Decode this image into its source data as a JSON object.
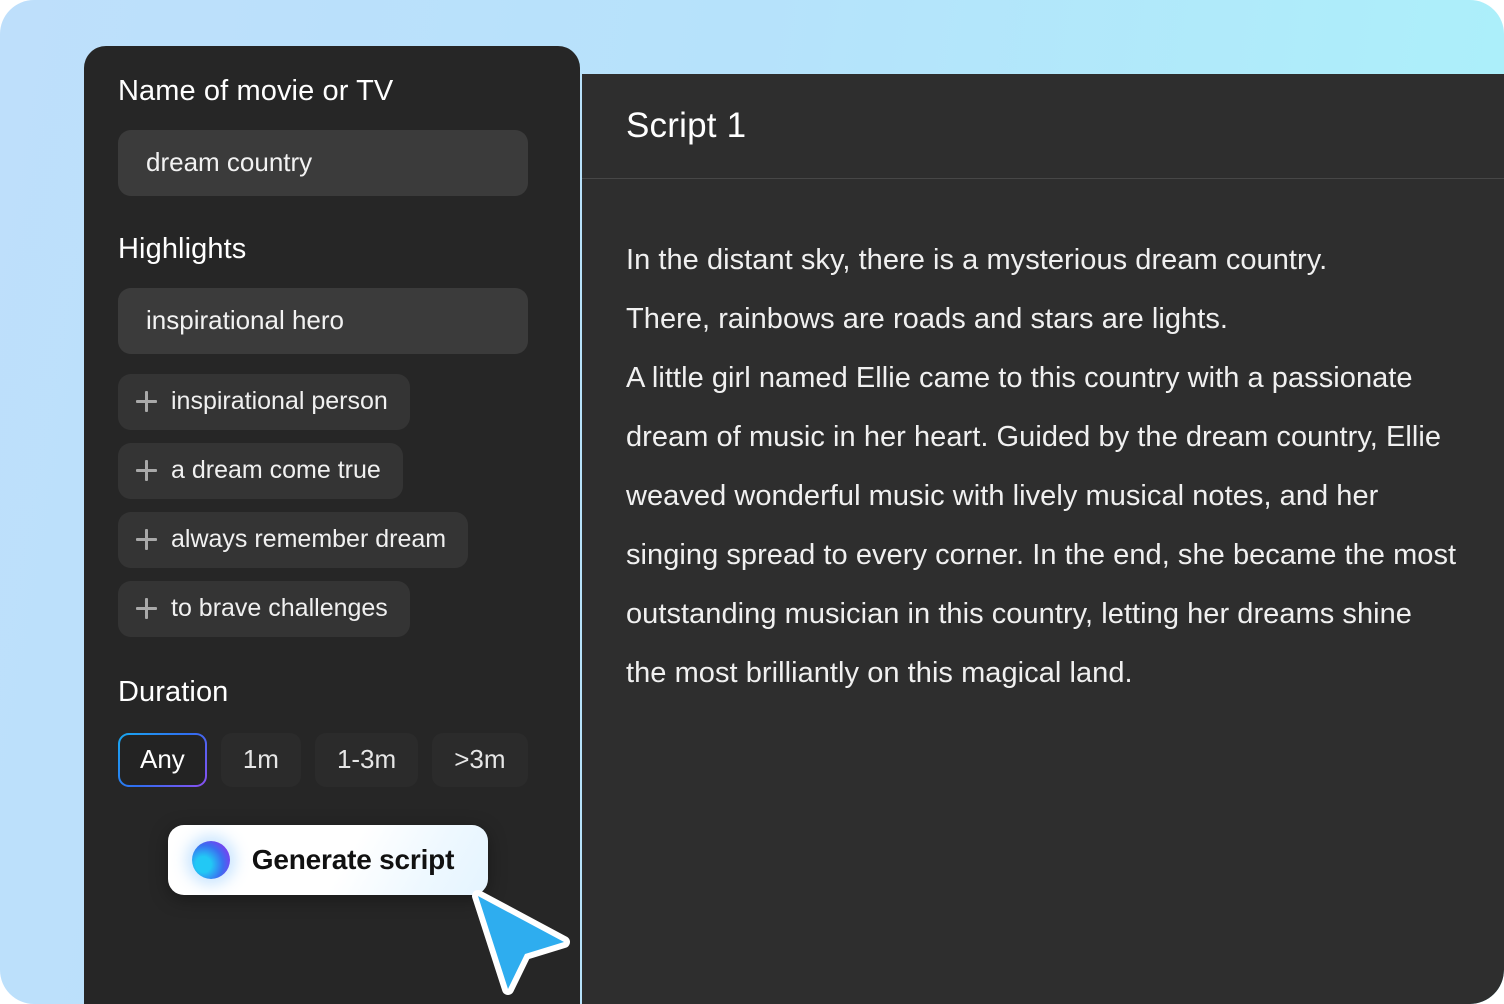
{
  "theme": {
    "background_gradient_start": "#bedffb",
    "background_gradient_end": "#aaf2fa",
    "panel_dark": "#262626",
    "panel_right_dark": "#2e2e2e",
    "input_bg": "#3b3b3b",
    "chip_bg": "#343434",
    "duration_bg": "#2b2b2b",
    "accent_border_start": "#18a9f0",
    "accent_border_end": "#8b4ff0",
    "cursor_blue": "#2eadef",
    "generate_button_bg": "#ffffff"
  },
  "left_panel": {
    "name_field": {
      "label": "Name of movie or TV",
      "value": "dream country",
      "placeholder": "Name of movie or TV"
    },
    "highlights": {
      "label": "Highlights",
      "value": "inspirational hero",
      "placeholder": "Highlights",
      "suggestions": [
        {
          "icon": "plus-icon",
          "label": "inspirational person"
        },
        {
          "icon": "plus-icon",
          "label": "a dream come true"
        },
        {
          "icon": "plus-icon",
          "label": "always remember dream"
        },
        {
          "icon": "plus-icon",
          "label": "to brave challenges"
        }
      ]
    },
    "duration": {
      "label": "Duration",
      "selected": "Any",
      "options": [
        "Any",
        "1m",
        "1-3m",
        ">3m"
      ]
    },
    "generate": {
      "label": "Generate script",
      "icon": "ai-orb-icon"
    }
  },
  "right_panel": {
    "title": "Script 1",
    "paragraphs": [
      "In the distant sky, there is a mysterious dream country.",
      "There, rainbows are roads and stars are lights.",
      "A little girl named Ellie came to this country with a passionate dream of music in her heart. Guided by the dream country, Ellie weaved wonderful music with lively musical notes, and her singing spread to every corner. In the end, she became the most outstanding musician in this country, letting her dreams shine the most brilliantly on this magical land."
    ]
  },
  "cursor": {
    "icon": "arrow-cursor-icon"
  }
}
